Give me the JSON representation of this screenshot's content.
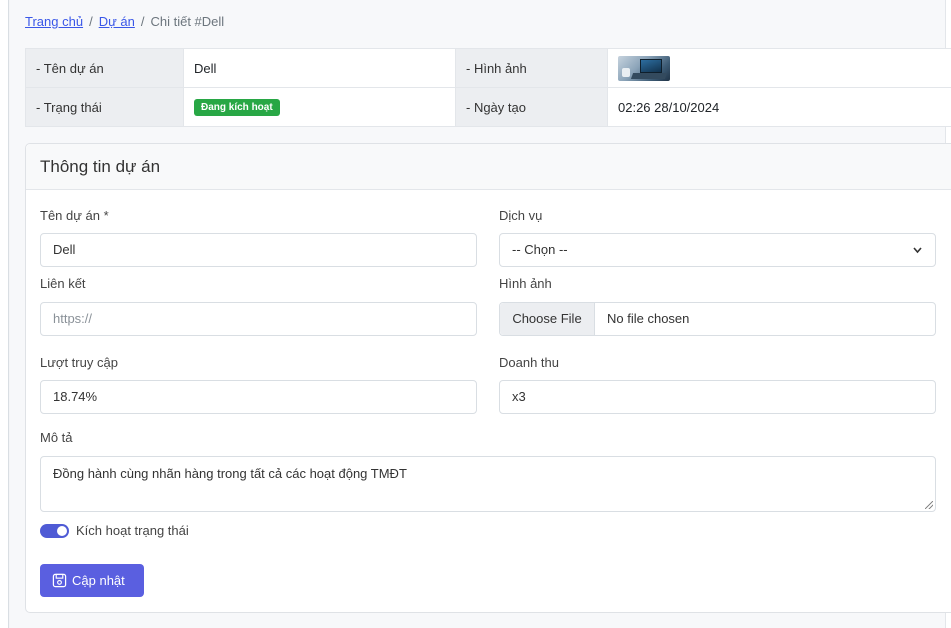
{
  "breadcrumb": {
    "home": "Trang chủ",
    "projects": "Dự án",
    "current": "Chi tiết #Dell",
    "separator": "/"
  },
  "summary": {
    "name_label": "- Tên dự án",
    "name_value": "Dell",
    "image_label": "- Hình ảnh",
    "status_label": "- Trạng thái",
    "status_value": "Đang kích hoạt",
    "created_label": "- Ngày tạo",
    "created_value": "02:26 28/10/2024"
  },
  "form": {
    "title": "Thông tin dự án",
    "name_label": "Tên dự án *",
    "name_value": "Dell",
    "service_label": "Dịch vụ",
    "service_selected": "-- Chọn --",
    "link_label": "Liên kết",
    "link_placeholder": "https://",
    "image_label": "Hình ảnh",
    "file_button": "Choose File",
    "file_status": "No file chosen",
    "visits_label": "Lượt truy cập",
    "visits_value": "18.74%",
    "revenue_label": "Doanh thu",
    "revenue_value": "x3",
    "description_label": "Mô tả",
    "description_value": "Đồng hành cùng nhãn hàng trong tất cả các hoạt động TMĐT",
    "toggle_label": "Kích hoạt trạng thái",
    "toggle_on": true,
    "submit_label": "Cập nhật"
  },
  "colors": {
    "accent": "#5a5fe0",
    "badge": "#28a745",
    "link": "#3a57e8"
  },
  "icons": {
    "save": "floppy-disk-icon",
    "chevron": "chevron-down-icon"
  }
}
